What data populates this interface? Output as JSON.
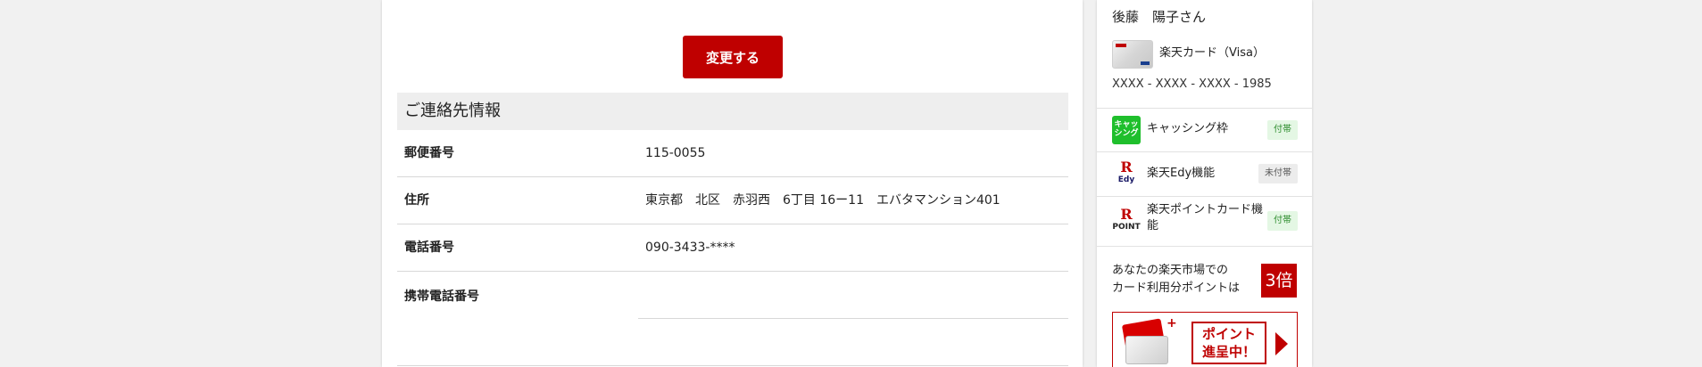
{
  "main": {
    "change_button": "変更する",
    "contact_section_title": "ご連絡先情報",
    "rows": [
      {
        "label": "郵便番号",
        "value": "115-0055"
      },
      {
        "label": "住所",
        "value": "東京都　北区　赤羽西　6丁目 16ー11　エバタマンション401"
      },
      {
        "label": "電話番号",
        "value": "090-3433-****"
      },
      {
        "label": "携帯電話番号",
        "value": ""
      }
    ]
  },
  "sidebar": {
    "user_name": "後藤　陽子さん",
    "card_name": "楽天カード（Visa）",
    "card_number": "XXXX - XXXX - XXXX - 1985",
    "features": [
      {
        "icon": "cashing-icon",
        "icon_text": "キャッ\nシング",
        "label": "キャッシング枠",
        "status": "付帯"
      },
      {
        "icon": "rakuten-edy-icon",
        "icon_text": "Edy",
        "label": "楽天Edy機能",
        "status": "未付帯"
      },
      {
        "icon": "rakuten-point-icon",
        "icon_text": "POINT",
        "label": "楽天ポイントカード機能",
        "status": "付帯"
      }
    ],
    "points_text": "あなたの楽天市場での\nカード利用分ポイントは",
    "points_multiplier": "3倍",
    "promo_text": "ポイント\n進呈中！"
  },
  "colors": {
    "brand_red": "#bf0000",
    "cashing_green": "#1fbf2c",
    "badge_on_bg": "#e4f7e4",
    "badge_off_bg": "#ececec"
  }
}
